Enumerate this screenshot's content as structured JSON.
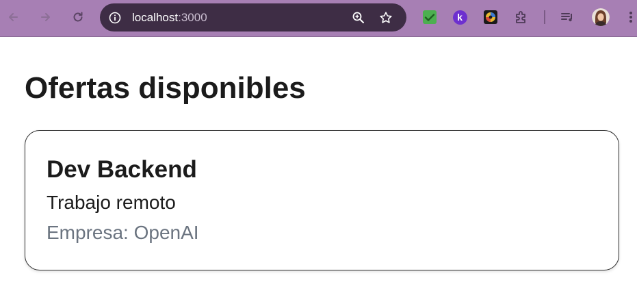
{
  "browser": {
    "url_host": "localhost",
    "url_port": ":3000",
    "icons": {
      "back": "arrow-left-icon",
      "forward": "arrow-right-icon",
      "reload": "reload-icon",
      "site_info": "info-icon",
      "zoom": "zoom-in-icon",
      "bookmark": "star-icon",
      "extensions": "puzzle-icon",
      "media": "playlist-icon",
      "menu": "kebab-menu-icon"
    },
    "extension_k_letter": "k",
    "colors": {
      "toolbar": "#a77fb4",
      "omnibox": "#3e2d45"
    }
  },
  "page": {
    "title": "Ofertas disponibles",
    "offers": [
      {
        "title": "Dev Backend",
        "type": "Trabajo remoto",
        "company": "Empresa: OpenAI"
      }
    ]
  }
}
